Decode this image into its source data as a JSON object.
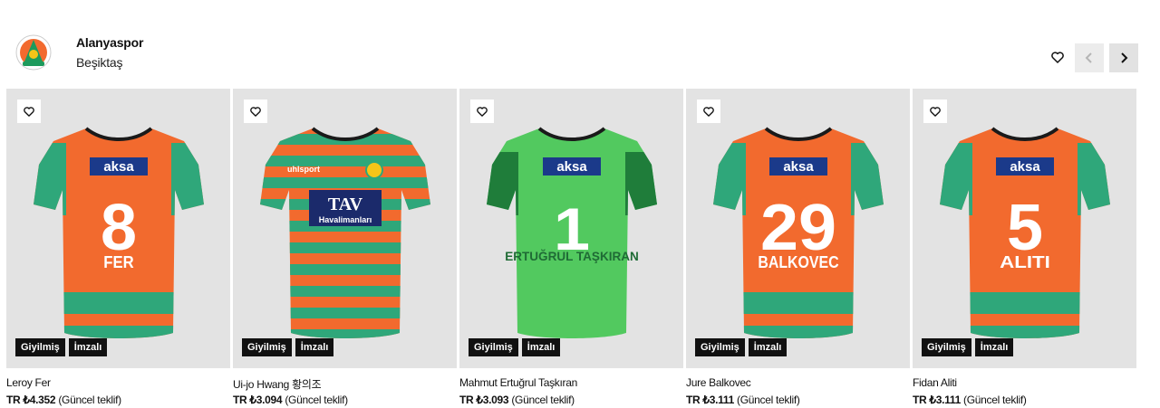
{
  "header": {
    "club": "Alanyaspor",
    "match": "Beşiktaş",
    "logo_icon": "alanyaspor-crest",
    "favorite_icon": "heart-icon",
    "prev_icon": "chevron-left-icon",
    "next_icon": "chevron-right-icon"
  },
  "products": [
    {
      "name": "Leroy Fer",
      "price": "TR ₺4.352",
      "price_note": "(Güncel teklif)",
      "tag1": "Giyilmiş",
      "tag2": "İmzalı",
      "number": "8",
      "player_print": "FER",
      "style": "orange",
      "sponsor": "aksa"
    },
    {
      "name": "Ui-jo Hwang 황의조",
      "price": "TR ₺3.094",
      "price_note": "(Güncel teklif)",
      "tag1": "Giyilmiş",
      "tag2": "İmzalı",
      "number": "",
      "player_print": "",
      "style": "striped",
      "sponsor": "TAV",
      "sponsor_sub": "Havalimanları",
      "brand": "uhlsport"
    },
    {
      "name": "Mahmut Ertuğrul Taşkıran",
      "price": "TR ₺3.093",
      "price_note": "(Güncel teklif)",
      "tag1": "Giyilmiş",
      "tag2": "İmzalı",
      "number": "1",
      "player_print": "ERTUĞRUL TAŞKIRAN",
      "style": "green",
      "sponsor": "aksa"
    },
    {
      "name": "Jure Balkovec",
      "price": "TR ₺3.111",
      "price_note": "(Güncel teklif)",
      "tag1": "Giyilmiş",
      "tag2": "İmzalı",
      "number": "29",
      "player_print": "BALKOVEC",
      "style": "orange",
      "sponsor": "aksa"
    },
    {
      "name": "Fidan Aliti",
      "price": "TR ₺3.111",
      "price_note": "(Güncel teklif)",
      "tag1": "Giyilmiş",
      "tag2": "İmzalı",
      "number": "5",
      "player_print": "ALITI",
      "style": "orange",
      "sponsor": "aksa"
    }
  ],
  "colors": {
    "orange": "#f26a2e",
    "green": "#2fa77a",
    "keeper_green": "#52c95f",
    "tag_bg": "#111111",
    "card_bg": "#e3e3e3"
  }
}
